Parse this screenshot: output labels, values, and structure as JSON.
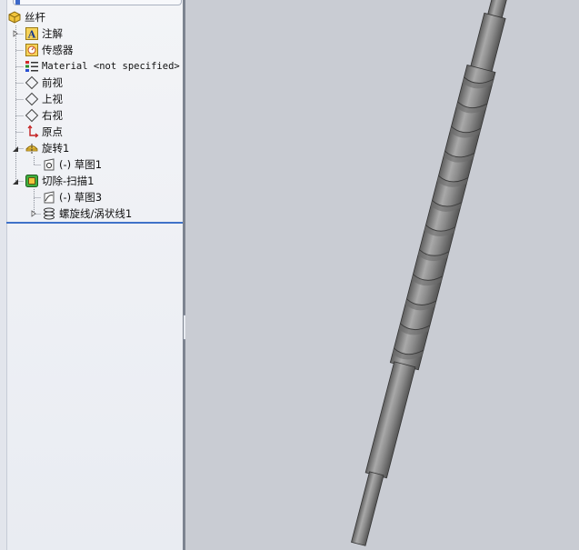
{
  "tree": {
    "root": {
      "label": "丝杆",
      "icon": "part-icon"
    },
    "items": [
      {
        "label": "注解",
        "icon": "annotations-icon"
      },
      {
        "label": "传感器",
        "icon": "sensors-icon"
      },
      {
        "label": "Material <not specified>",
        "icon": "material-icon"
      },
      {
        "label": "前视",
        "icon": "plane-icon"
      },
      {
        "label": "上视",
        "icon": "plane-icon"
      },
      {
        "label": "右视",
        "icon": "plane-icon"
      },
      {
        "label": "原点",
        "icon": "origin-icon"
      },
      {
        "label": "旋转1",
        "icon": "revolve-icon"
      },
      {
        "label": "(-) 草图1",
        "icon": "sketch-icon"
      },
      {
        "label": "切除-扫描1",
        "icon": "cut-sweep-icon"
      },
      {
        "label": "(-) 草图3",
        "icon": "sketch-icon"
      },
      {
        "label": "螺旋线/涡状线1",
        "icon": "helix-icon"
      }
    ]
  },
  "colors": {
    "viewport_background": "#c9ccd3",
    "rollback_bar": "#3f72c8",
    "model_gray": "#8e8e8e"
  }
}
